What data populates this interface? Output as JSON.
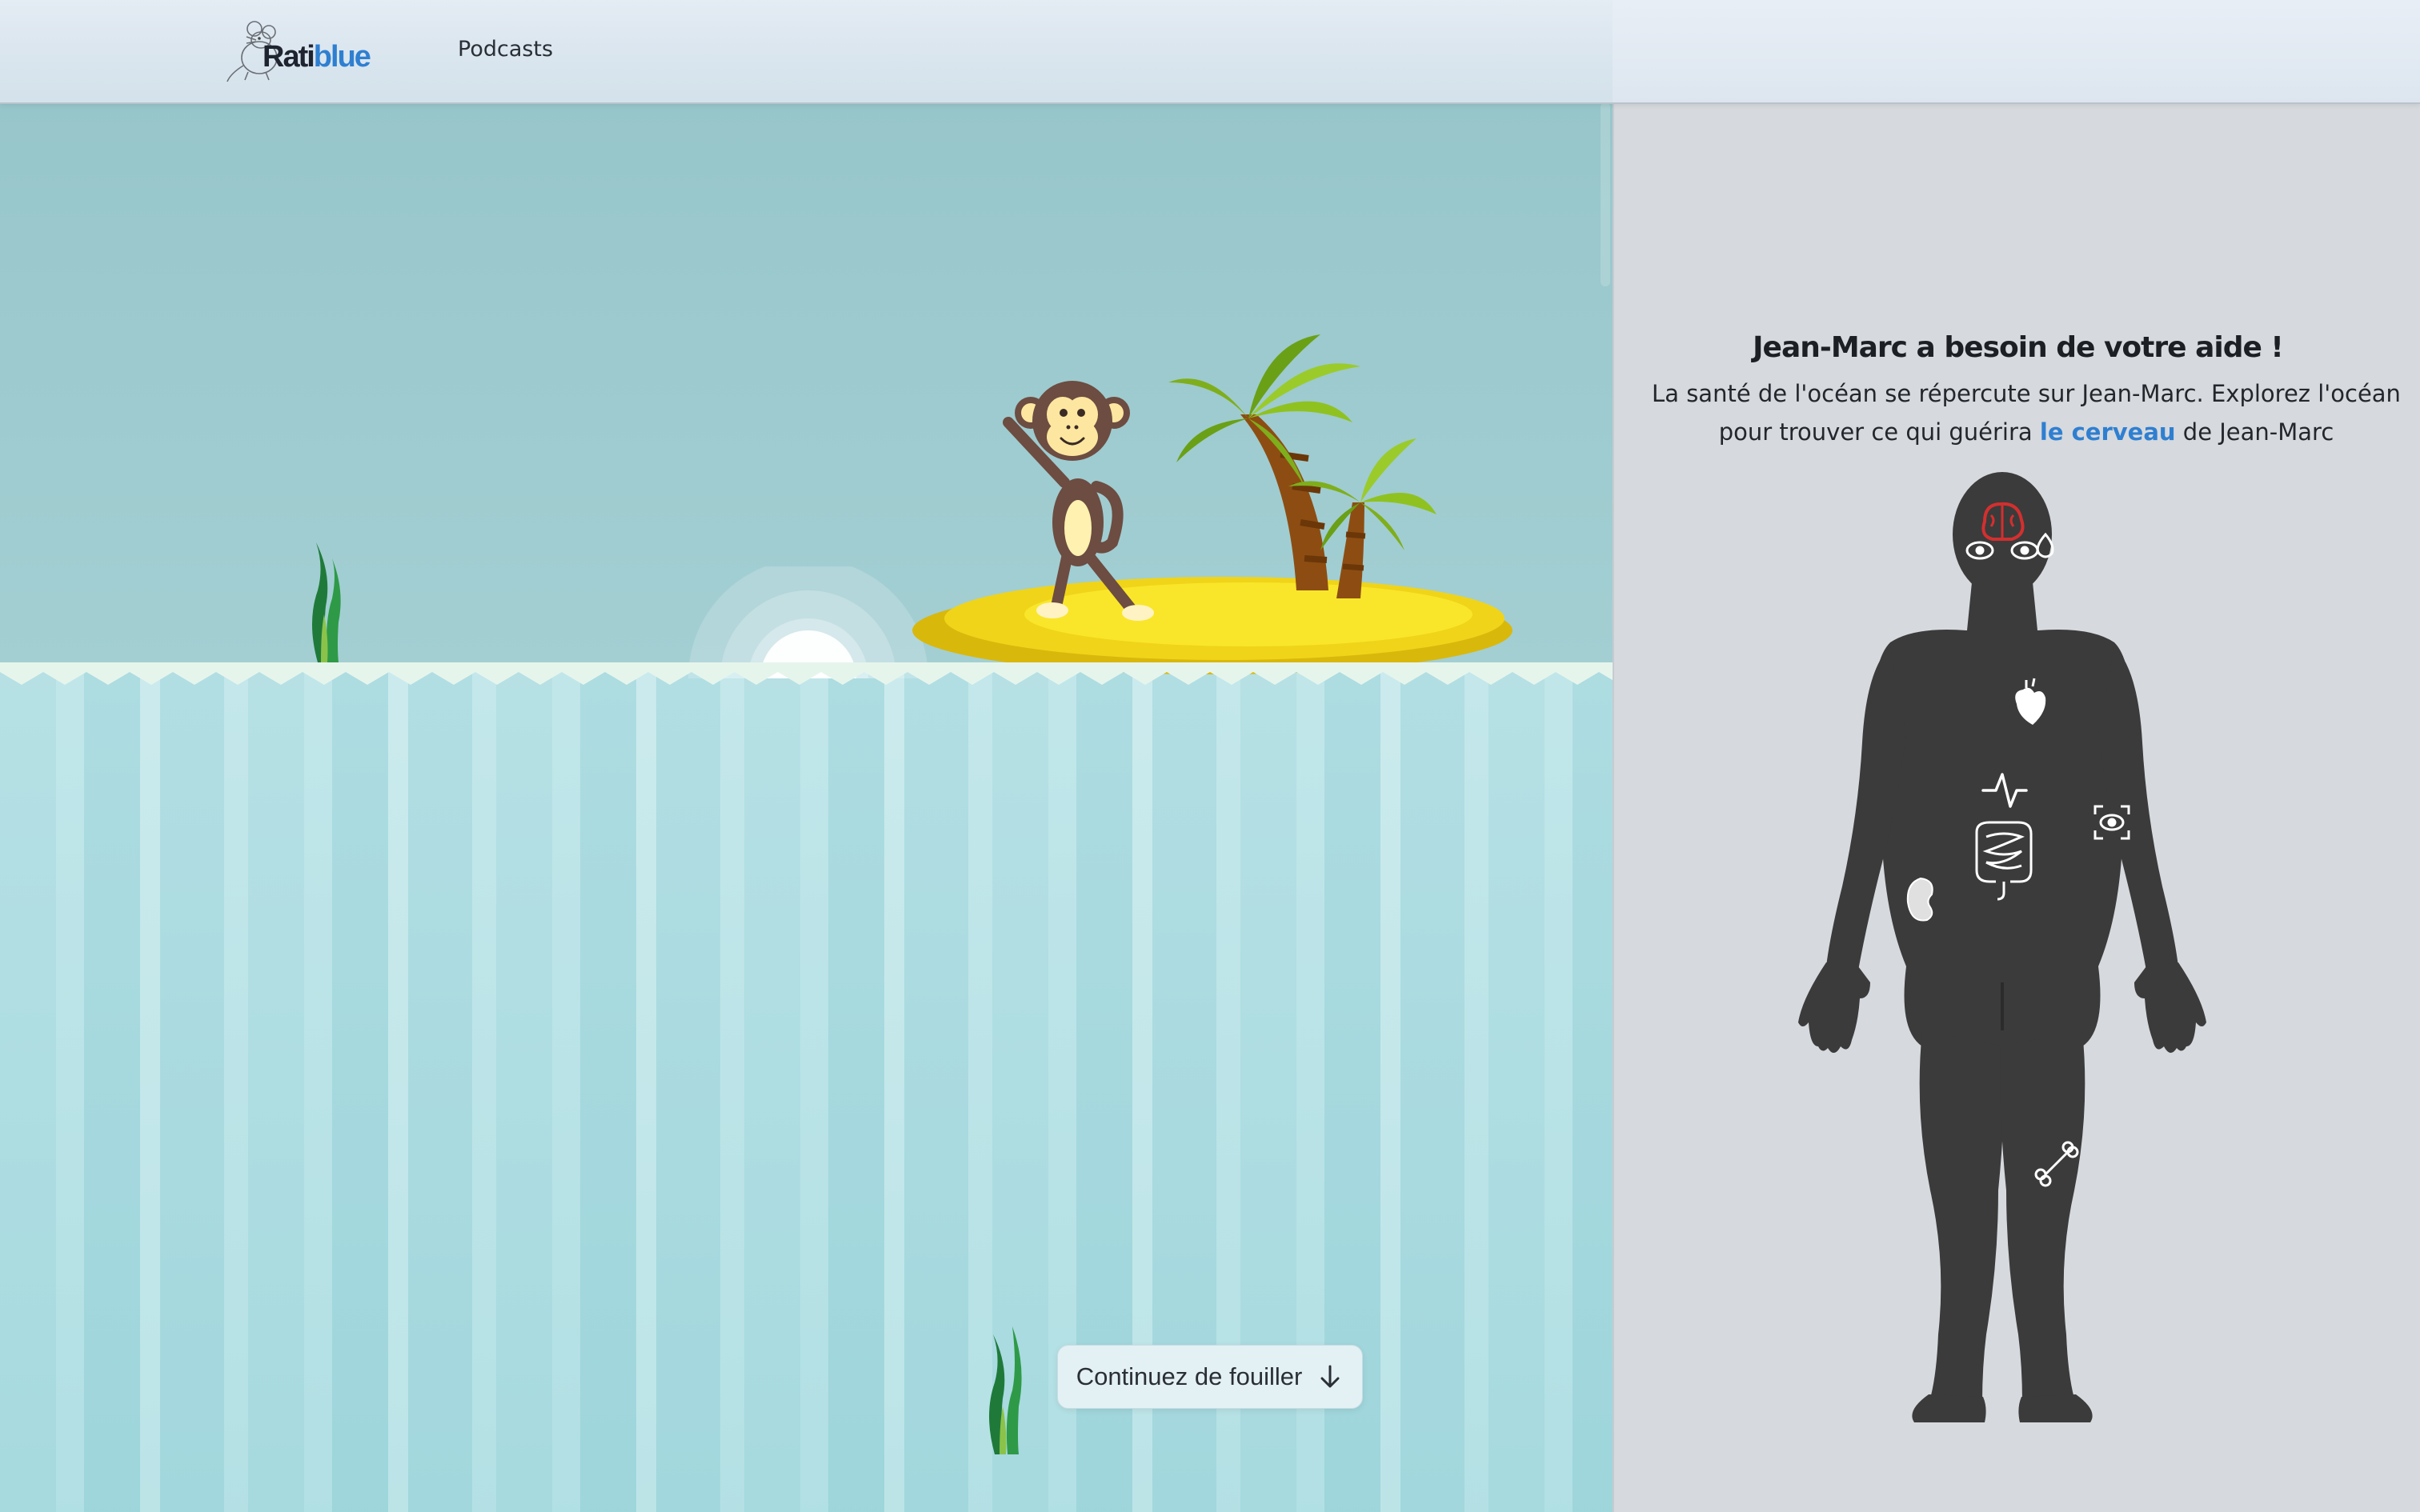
{
  "header": {
    "logo": {
      "text_dark": "Rati",
      "text_blue": "blue"
    },
    "nav": [
      {
        "label": "Podcasts"
      }
    ]
  },
  "scene": {
    "continue_button": {
      "label": "Continuez de fouiller",
      "icon": "arrow-down-icon"
    }
  },
  "panel": {
    "title": "Jean-Marc a besoin de votre aide !",
    "description_part1": "La santé de l'océan se répercute sur Jean-Marc. Explorez l'océan pour trouver ce qui guérira ",
    "description_highlight": "le cerveau",
    "description_part2": " de Jean-Marc"
  },
  "colors": {
    "accent": "#2f7fd1",
    "body": "#3a3a3a",
    "organ_active": "#d32f2f",
    "sky": "#99c8cc",
    "sea": "#a9dbe0",
    "island": "#f5dc1b"
  },
  "body_icons": [
    {
      "name": "brain-icon",
      "state": "active"
    },
    {
      "name": "eyes-icon",
      "state": "inactive"
    },
    {
      "name": "drop-icon",
      "state": "inactive"
    },
    {
      "name": "heart-icon",
      "state": "inactive"
    },
    {
      "name": "pulse-icon",
      "state": "inactive"
    },
    {
      "name": "skin-scan-icon",
      "state": "inactive"
    },
    {
      "name": "intestines-icon",
      "state": "inactive"
    },
    {
      "name": "kidney-icon",
      "state": "inactive"
    },
    {
      "name": "bone-icon",
      "state": "inactive"
    }
  ]
}
